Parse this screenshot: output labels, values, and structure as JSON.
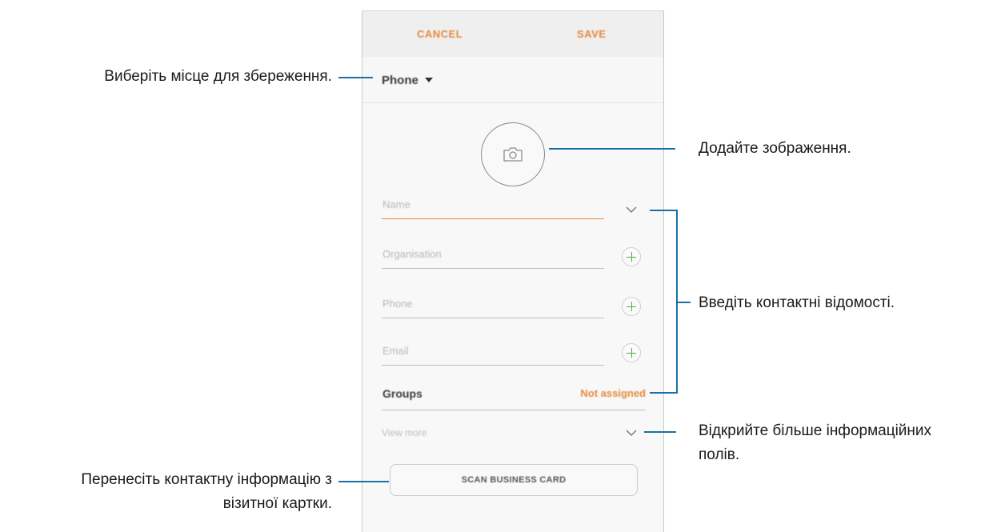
{
  "phone": {
    "topbar": {
      "cancel_label": "CANCEL",
      "save_label": "SAVE"
    },
    "storage": {
      "label": "Phone"
    },
    "form": {
      "name_placeholder": "Name",
      "organisation_placeholder": "Organisation",
      "phone_placeholder": "Phone",
      "email_placeholder": "Email",
      "groups_label": "Groups",
      "groups_value": "Not assigned",
      "view_more_label": "View more",
      "scan_button_label": "SCAN BUSINESS CARD"
    },
    "icons": [
      "camera-icon",
      "chevron-down-icon",
      "plus-icon",
      "dropdown-caret-icon"
    ],
    "colors": {
      "accent": "#e6893b",
      "plus": "#4caf50",
      "callout_line": "#1b6fa8"
    }
  },
  "annotations": {
    "storage": "Виберіть місце для збереження.",
    "photo": "Додайте зображення.",
    "contact_info": "Введіть контактні відомості.",
    "more_fields_line1": "Відкрийте більше інформаційних",
    "more_fields_line2": "полів.",
    "scan_line1": "Перенесіть контактну інформацію з",
    "scan_line2": "візитної картки."
  }
}
